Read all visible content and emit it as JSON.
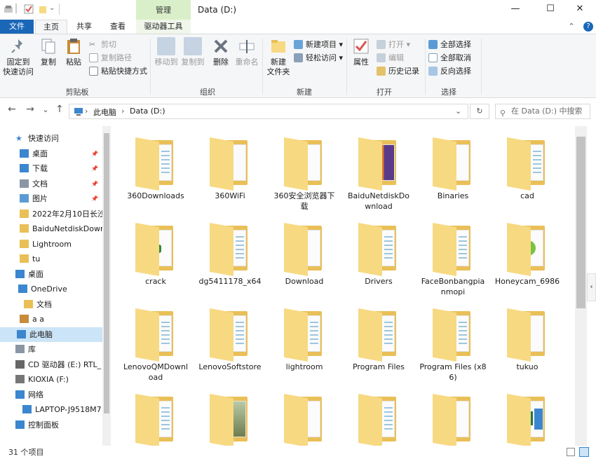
{
  "titlebar": {
    "manage_tab": "管理",
    "title": "Data (D:)",
    "minimize": "—",
    "maximize": "☐",
    "close": "✕"
  },
  "tabs": {
    "file": "文件",
    "home": "主页",
    "share": "共享",
    "view": "查看",
    "drive_tools": "驱动器工具",
    "collapse": "⌃",
    "help": "?"
  },
  "ribbon": {
    "pin_quick_access": [
      "固定到",
      "快速访问"
    ],
    "copy": "复制",
    "paste": "粘贴",
    "cut": "剪切",
    "copy_path": "复制路径",
    "paste_shortcut": "粘贴快捷方式",
    "group_clipboard": "剪贴板",
    "move_to": "移动到",
    "copy_to": "复制到",
    "delete": "删除",
    "rename": "重命名",
    "group_organize": "组织",
    "new_folder": [
      "新建",
      "文件夹"
    ],
    "new_item": "新建项目",
    "easy_access": "轻松访问",
    "group_new": "新建",
    "properties": "属性",
    "open": "打开",
    "edit": "编辑",
    "history": "历史记录",
    "group_open": "打开",
    "select_all": "全部选择",
    "select_none": "全部取消",
    "invert_selection": "反向选择",
    "group_select": "选择"
  },
  "address": {
    "back": "←",
    "forward": "→",
    "recent": "⌄",
    "up": "↑",
    "path": [
      "此电脑",
      "Data (D:)"
    ],
    "dropdown": "⌄",
    "refresh": "↻",
    "search_placeholder": "在 Data (D:) 中搜索"
  },
  "sidebar": {
    "items": [
      {
        "label": "快速访问",
        "pinned": false
      },
      {
        "label": "桌面",
        "pinned": true
      },
      {
        "label": "下载",
        "pinned": true
      },
      {
        "label": "文档",
        "pinned": true
      },
      {
        "label": "图片",
        "pinned": true
      },
      {
        "label": "2022年2月10日长沙",
        "pinned": false
      },
      {
        "label": "BaiduNetdiskDown",
        "pinned": false
      },
      {
        "label": "Lightroom",
        "pinned": false
      },
      {
        "label": "tu",
        "pinned": false
      },
      {
        "label": "桌面",
        "pinned": false
      },
      {
        "label": "OneDrive",
        "pinned": false
      },
      {
        "label": "文档",
        "pinned": false
      },
      {
        "label": "a a",
        "pinned": false
      },
      {
        "label": "此电脑",
        "pinned": false
      },
      {
        "label": "库",
        "pinned": false
      },
      {
        "label": "CD 驱动器 (E:) RTL_",
        "pinned": false
      },
      {
        "label": "KIOXIA (F:)",
        "pinned": false
      },
      {
        "label": "网络",
        "pinned": false
      },
      {
        "label": "LAPTOP-J9518M7",
        "pinned": false
      },
      {
        "label": "控制面板",
        "pinned": false
      }
    ],
    "pin_glyph": "📌"
  },
  "files": [
    {
      "name": "360Downloads",
      "kind": "doc"
    },
    {
      "name": "360WiFi",
      "kind": "plain"
    },
    {
      "name": "360安全浏览器下载",
      "kind": "plain"
    },
    {
      "name": "BaiduNetdiskDownload",
      "kind": "winrar"
    },
    {
      "name": "Binaries",
      "kind": "white"
    },
    {
      "name": "cad",
      "kind": "doc"
    },
    {
      "name": "crack",
      "kind": "green"
    },
    {
      "name": "dg5411178_x64",
      "kind": "doc"
    },
    {
      "name": "Download",
      "kind": "white"
    },
    {
      "name": "Drivers",
      "kind": "doc"
    },
    {
      "name": "FaceBonbangpianmopi",
      "kind": "doc"
    },
    {
      "name": "Honeycam_6986",
      "kind": "honeycam"
    },
    {
      "name": "LenovoQMDownload",
      "kind": "doc"
    },
    {
      "name": "LenovoSoftstore",
      "kind": "doc"
    },
    {
      "name": "lightroom",
      "kind": "doc"
    },
    {
      "name": "Program Files",
      "kind": "doc"
    },
    {
      "name": "Program Files (x86)",
      "kind": "doc"
    },
    {
      "name": "tukuo",
      "kind": "white"
    },
    {
      "name": "",
      "kind": "doc"
    },
    {
      "name": "",
      "kind": "photo"
    },
    {
      "name": "",
      "kind": "white"
    },
    {
      "name": "",
      "kind": "doc"
    },
    {
      "name": "",
      "kind": "blue"
    },
    {
      "name": "",
      "kind": "excel"
    }
  ],
  "status": {
    "count": "31 个项目"
  },
  "colors": {
    "file_tab": "#1a67b8",
    "manage_tab": "#d9efc9",
    "folder_front": "#f7d982",
    "folder_back": "#e9bf57",
    "selection": "#cce4f7"
  }
}
